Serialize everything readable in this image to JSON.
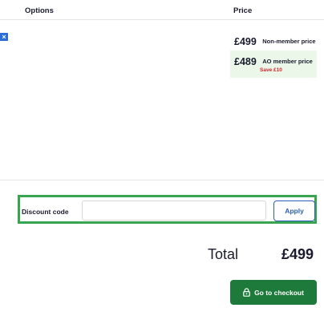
{
  "header": {
    "options_label": "Options",
    "price_label": "Price"
  },
  "item": {
    "remove_icon": "close-icon",
    "non_member_price": "£499",
    "non_member_label": "Non-member price",
    "member_price": "£489",
    "member_label": "AO member price",
    "saving": "Save £10"
  },
  "discount": {
    "label": "Discount code",
    "value": "",
    "placeholder": "",
    "apply_label": "Apply"
  },
  "summary": {
    "total_label": "Total",
    "total_value": "£499"
  },
  "checkout": {
    "label": "Go to checkout",
    "icon": "lock-icon"
  },
  "colors": {
    "accent_green": "#1e7a3a",
    "highlight_border": "#3aa551",
    "member_bg": "#eaf7e9",
    "save_red": "#d8232a",
    "link_blue": "#2b5fb8"
  }
}
